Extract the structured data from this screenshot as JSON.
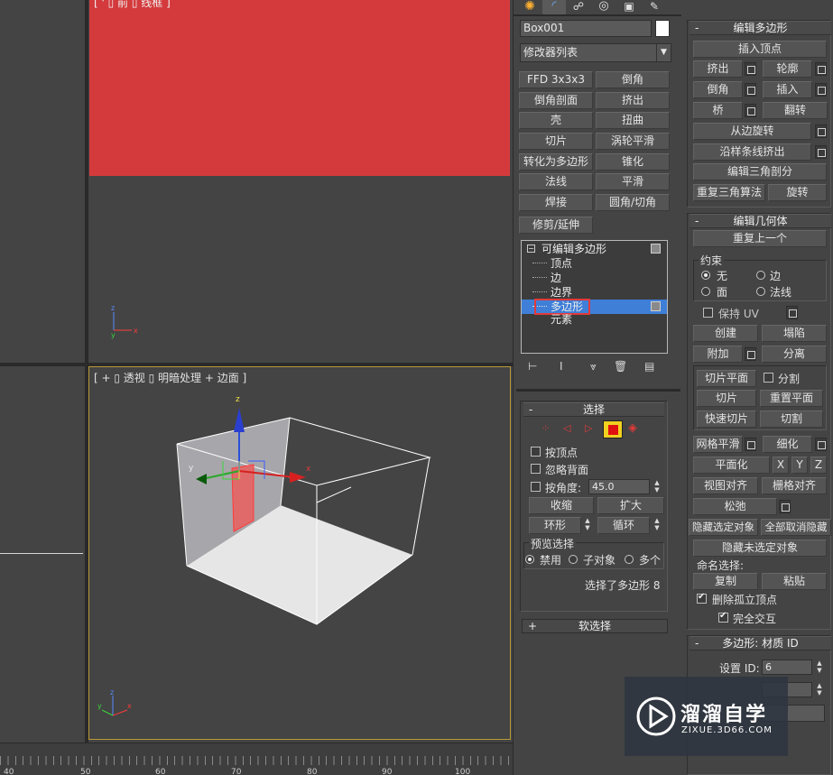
{
  "viewports": {
    "top_left_label": "[ ' ▯ 前 ▯ 线框 ]",
    "perspective_label": "[ + ▯ 透视 ▯ 明暗处理 + 边面 ]",
    "gizmo_z": "z",
    "gizmo_y": "y",
    "gizmo_x": "x"
  },
  "command_panel": {
    "tab_icons": [
      "create-icon",
      "modify-icon",
      "hierarchy-icon",
      "motion-icon",
      "display-icon",
      "utilities-icon"
    ],
    "object_name": "Box001",
    "modifier_list": "修改器列表",
    "modifier_buttons": [
      [
        "FFD 3x3x3",
        "倒角"
      ],
      [
        "倒角剖面",
        "挤出"
      ],
      [
        "壳",
        "扭曲"
      ],
      [
        "切片",
        "涡轮平滑"
      ],
      [
        "转化为多边形",
        "锥化"
      ],
      [
        "法线",
        "平滑"
      ],
      [
        "焊接",
        "圆角/切角"
      ]
    ],
    "trim_extend": "修剪/延伸",
    "stack": {
      "root": "可编辑多边形",
      "items": [
        "顶点",
        "边",
        "边界",
        "多边形",
        "元素"
      ],
      "selected": "多边形"
    },
    "selection": {
      "title": "选择",
      "by_vertex": "按顶点",
      "ignore_backface": "忽略背面",
      "by_angle": "按角度:",
      "angle_value": "45.0",
      "shrink": "收缩",
      "grow": "扩大",
      "ring": "环形",
      "loop": "循环",
      "preview_title": "预览选择",
      "preview_disabled": "禁用",
      "preview_subobject": "子对象",
      "preview_multi": "多个",
      "status": "选择了多边形 8"
    },
    "soft_selection": "软选择",
    "soft_selection_sign": "+"
  },
  "edit_polygons": {
    "title": "编辑多边形",
    "insert_vertex": "插入顶点",
    "extrude": "挤出",
    "outline": "轮廓",
    "bevel": "倒角",
    "inset": "插入",
    "bridge": "桥",
    "flip": "翻转",
    "hinge": "从边旋转",
    "extrude_spline": "沿样条线挤出",
    "edit_triangulation": "编辑三角剖分",
    "retriangulate": "重复三角算法",
    "turn": "旋转"
  },
  "edit_geometry": {
    "title": "编辑几何体",
    "repeat_last": "重复上一个",
    "constraints": "约束",
    "c_none": "无",
    "c_edge": "边",
    "c_face": "面",
    "c_normal": "法线",
    "preserve_uv": "保持 UV",
    "create": "创建",
    "collapse": "塌陷",
    "attach": "附加",
    "detach": "分离",
    "slice_plane": "切片平面",
    "split": "分割",
    "slice": "切片",
    "reset_plane": "重置平面",
    "quickslice": "快速切片",
    "cut": "切割",
    "meshsmooth": "网格平滑",
    "tessellate": "细化",
    "make_planar": "平面化",
    "x": "X",
    "y": "Y",
    "z": "Z",
    "view_align": "视图对齐",
    "grid_align": "栅格对齐",
    "relax": "松弛",
    "hide_selected": "隐藏选定对象",
    "unhide_all": "全部取消隐藏",
    "hide_unselected": "隐藏未选定对象",
    "named_selections": "命名选择:",
    "copy": "复制",
    "paste": "粘贴",
    "delete_isolated": "删除孤立顶点",
    "full_interactivity": "完全交互"
  },
  "material_ids": {
    "title": "多边形: 材质 ID",
    "set_id_label": "设置 ID:",
    "set_id_value": "6"
  },
  "timeline": {
    "ticks": [
      "40",
      "50",
      "60",
      "70",
      "80",
      "90",
      "100"
    ]
  },
  "watermark": {
    "title": "溜溜自学",
    "url": "ZIXUE.3D66.COM"
  },
  "colors": {
    "viewport_bg": "#444444",
    "red_plane": "#d43a3c",
    "selection_blue": "#3f7fd8",
    "active_border": "#b89a3a",
    "highlight_box": "#e23a3a"
  }
}
